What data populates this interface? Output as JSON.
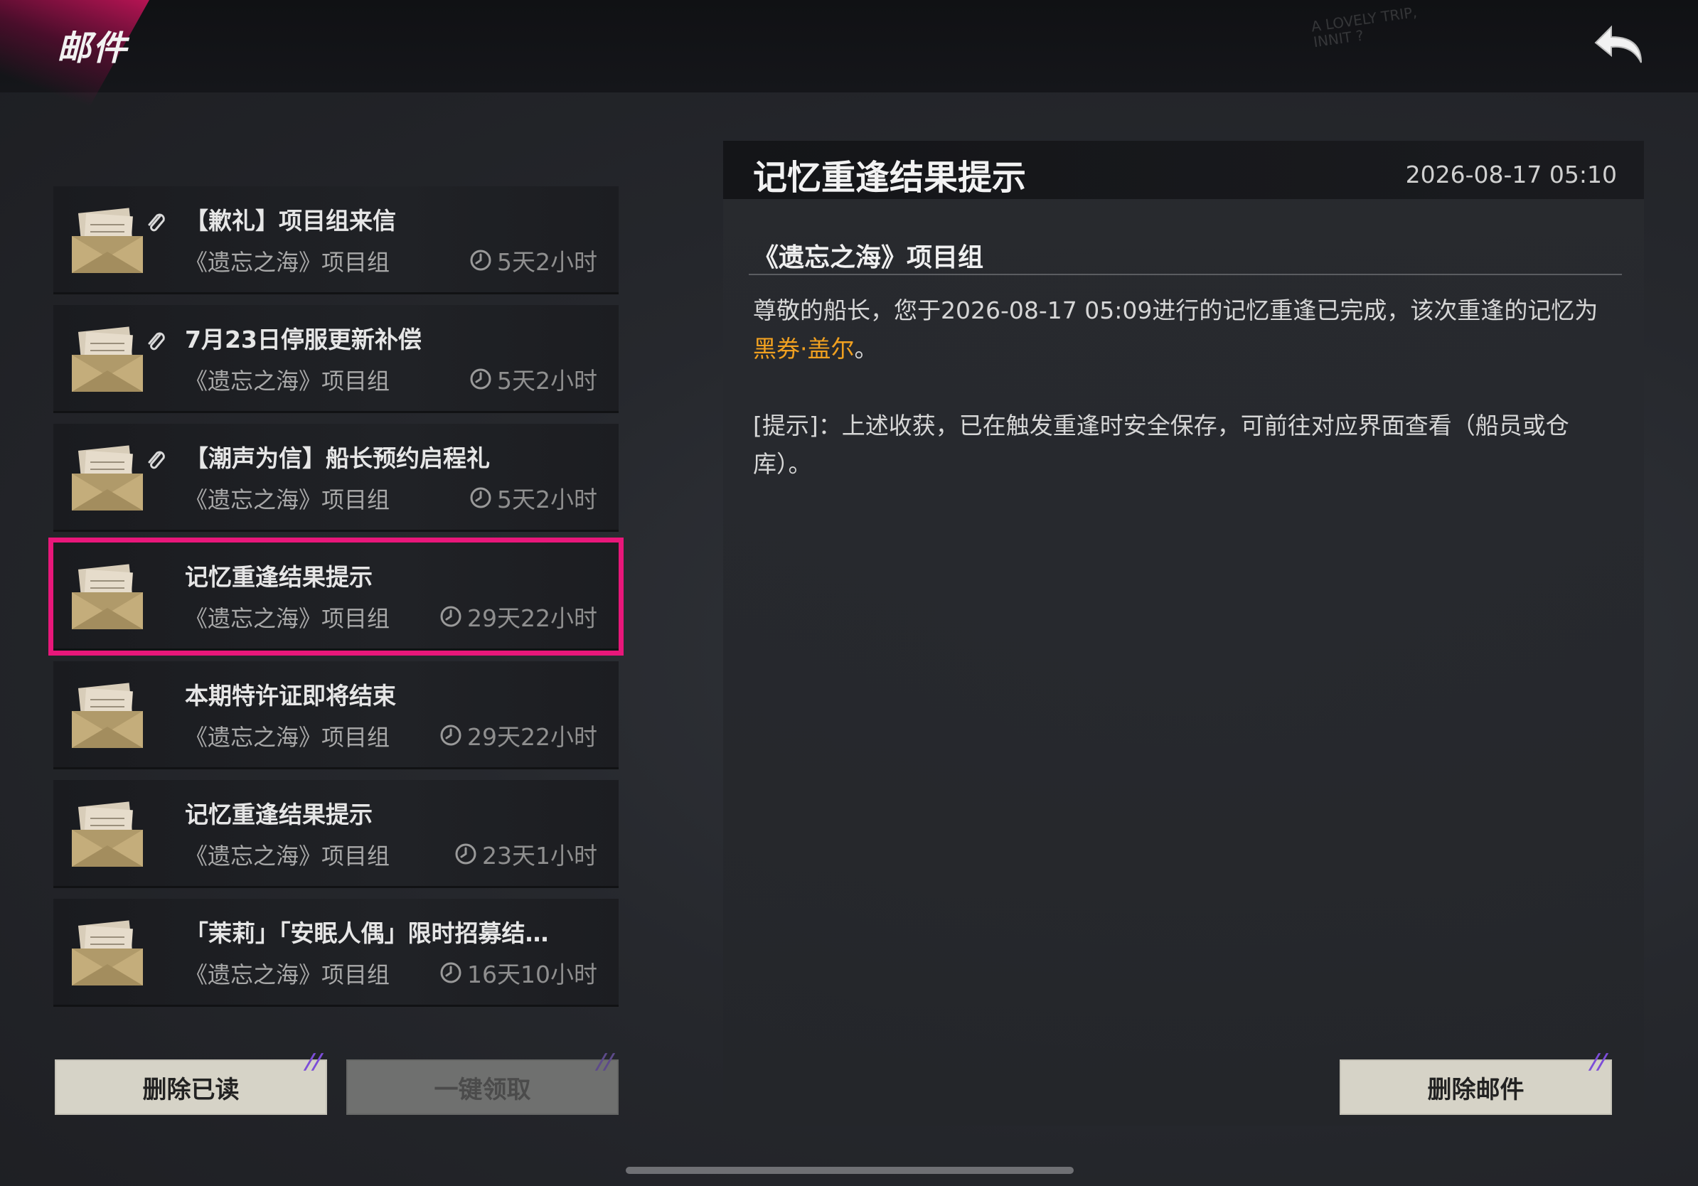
{
  "header": {
    "title": "邮件",
    "deco_text": "A LOVELY TRIP,\nINNIT ?"
  },
  "mails": [
    {
      "title": "【歉礼】项目组来信",
      "sender": "《遗忘之海》项目组",
      "expire": "5天2小时",
      "attachment": true,
      "selected": false
    },
    {
      "title": "7月23日停服更新补偿",
      "sender": "《遗忘之海》项目组",
      "expire": "5天2小时",
      "attachment": true,
      "selected": false
    },
    {
      "title": "【潮声为信】船长预约启程礼",
      "sender": "《遗忘之海》项目组",
      "expire": "5天2小时",
      "attachment": true,
      "selected": false
    },
    {
      "title": "记忆重逢结果提示",
      "sender": "《遗忘之海》项目组",
      "expire": "29天22小时",
      "attachment": false,
      "selected": true
    },
    {
      "title": "本期特许证即将结束",
      "sender": "《遗忘之海》项目组",
      "expire": "29天22小时",
      "attachment": false,
      "selected": false
    },
    {
      "title": "记忆重逢结果提示",
      "sender": "《遗忘之海》项目组",
      "expire": "23天1小时",
      "attachment": false,
      "selected": false
    },
    {
      "title": "「茉莉」「安眠人偶」限时招募结…",
      "sender": "《遗忘之海》项目组",
      "expire": "16天10小时",
      "attachment": false,
      "selected": false
    }
  ],
  "buttons": {
    "delete_read": "删除已读",
    "claim_all": "一键领取",
    "delete_mail": "删除邮件"
  },
  "detail": {
    "title": "记忆重逢结果提示",
    "date": "2026-08-17 05:10",
    "sender": "《遗忘之海》项目组",
    "body_prefix": "尊敬的船长，您于2026-08-17 05:09进行的记忆重逢已完成，该次重逢的记忆为",
    "body_highlight": "黑券·盖尔",
    "body_suffix": "。",
    "tip": "[提示]：上述收获，已在触发重逢时安全保存，可前往对应界面查看（船员或仓库）。"
  },
  "colors": {
    "accent": "#e8177a",
    "highlight": "#f0a020"
  }
}
